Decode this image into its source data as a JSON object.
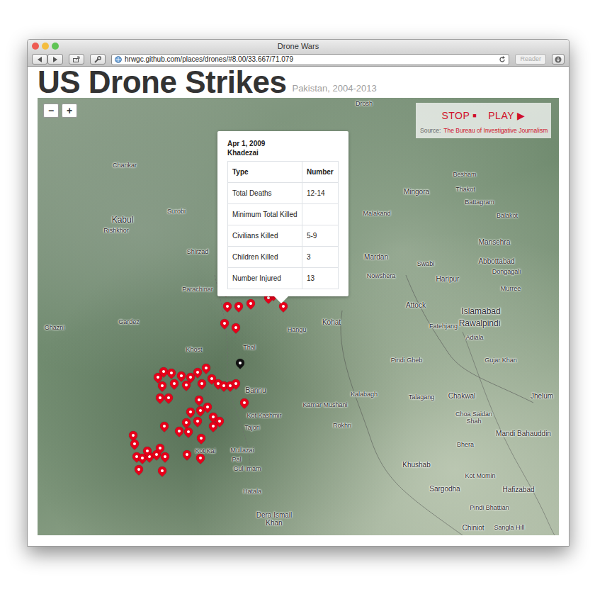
{
  "window": {
    "title": "Drone Wars"
  },
  "toolbar": {
    "url": "hrwgc.github.com/places/drones/#8.00/33.667/71.079",
    "reader": "Reader"
  },
  "page": {
    "title": "US Drone Strikes",
    "subtitle": "Pakistan, 2004-2013"
  },
  "zoom": {
    "out": "−",
    "in": "+"
  },
  "playback": {
    "stop": "STOP",
    "stop_icon": "■",
    "play": "PLAY",
    "play_icon": "▶",
    "source_label": "Source:",
    "source": "The Bureau of Investigative Journalism"
  },
  "popup": {
    "date": "Apr 1, 2009",
    "place": "Khadezai",
    "columns": [
      "Type",
      "Number"
    ],
    "rows": [
      [
        "Total Deaths",
        "12-14"
      ],
      [
        "Minimum Total Killed",
        ""
      ],
      [
        "Civilians Killed",
        "5-9"
      ],
      [
        "Children Killed",
        "3"
      ],
      [
        "Number Injured",
        "13"
      ]
    ]
  },
  "labels": [
    "Kabul",
    "Charikar",
    "Surobi",
    "Rishkhor",
    "Shirzad",
    "Parachinar",
    "Ghazni",
    "Gardez",
    "Khost",
    "Thal",
    "Hangu",
    "Kohat",
    "Bannu",
    "Kot Kashmir",
    "Tajori",
    "Mullazai",
    "Pal",
    "Gul Imam",
    "Hatala",
    "Dera Ismail Khan",
    "Kot Kai",
    "Drosh",
    "Mingora",
    "Besham",
    "Thakot",
    "Battagram",
    "Balakot",
    "Malakand",
    "Mardan",
    "Nowshera",
    "Swabi",
    "Mansehra",
    "Abbottabad",
    "Dongagali",
    "Haripur",
    "Murree",
    "Attock",
    "Islamabad",
    "Rawalpindi",
    "Fatehjang",
    "Adiala",
    "Gujar Khan",
    "Pindi Gheb",
    "Kalabagh",
    "Kamar Mushani",
    "Rokhri",
    "Talagang",
    "Chakwal",
    "Jhelum",
    "Choa Saidan Shah",
    "Mandi Bahauddin",
    "Bhera",
    "Khushab",
    "Kot Momin",
    "Sargodha",
    "Hafizabad",
    "Pindi Bhattian",
    "Chiniot",
    "Sangla Hill"
  ],
  "markers": [
    {
      "selected": false
    },
    {
      "selected": false
    },
    {
      "selected": false
    },
    {
      "selected": false
    },
    {
      "selected": false
    },
    {
      "selected": false
    },
    {
      "selected": false
    },
    {
      "selected": false
    },
    {
      "selected": false
    },
    {
      "selected": false
    },
    {
      "selected": false
    },
    {
      "selected": false
    },
    {
      "selected": false
    },
    {
      "selected": false
    },
    {
      "selected": false
    },
    {
      "selected": false
    },
    {
      "selected": false
    },
    {
      "selected": false
    },
    {
      "selected": false
    },
    {
      "selected": false
    },
    {
      "selected": false
    },
    {
      "selected": false
    },
    {
      "selected": false
    },
    {
      "selected": false
    },
    {
      "selected": false
    },
    {
      "selected": false
    },
    {
      "selected": false
    },
    {
      "selected": false
    },
    {
      "selected": false
    },
    {
      "selected": false
    },
    {
      "selected": false
    },
    {
      "selected": false
    },
    {
      "selected": false
    },
    {
      "selected": false
    },
    {
      "selected": false
    },
    {
      "selected": false
    },
    {
      "selected": false
    },
    {
      "selected": false
    },
    {
      "selected": false
    },
    {
      "selected": false
    },
    {
      "selected": false
    },
    {
      "selected": false
    },
    {
      "selected": false
    },
    {
      "selected": false
    },
    {
      "selected": false
    },
    {
      "selected": false
    },
    {
      "selected": false
    },
    {
      "selected": false
    },
    {
      "selected": false
    },
    {
      "selected": false
    },
    {
      "selected": false
    },
    {
      "selected": false
    },
    {
      "selected": false
    },
    {
      "selected": false
    },
    {
      "selected": true
    }
  ]
}
